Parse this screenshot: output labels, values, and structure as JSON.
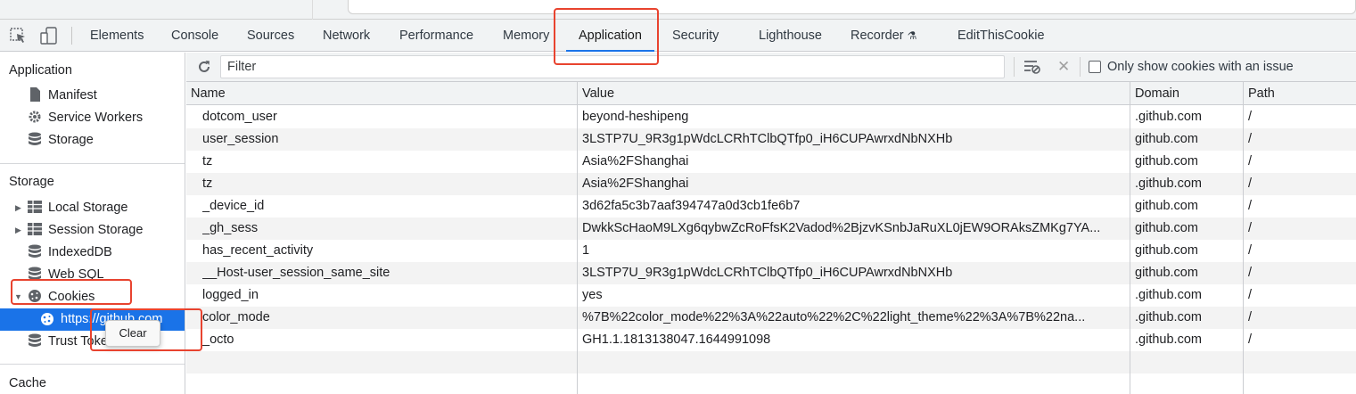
{
  "devtools": {
    "tabs": [
      {
        "label": "Elements"
      },
      {
        "label": "Console"
      },
      {
        "label": "Sources"
      },
      {
        "label": "Network"
      },
      {
        "label": "Performance"
      },
      {
        "label": "Memory"
      },
      {
        "label": "Application",
        "active": true
      },
      {
        "label": "Security"
      },
      {
        "label": "Lighthouse"
      },
      {
        "label": "Recorder"
      },
      {
        "label": "EditThisCookie"
      }
    ]
  },
  "sidebar": {
    "application": {
      "title": "Application",
      "items": [
        {
          "label": "Manifest",
          "icon": "document-icon"
        },
        {
          "label": "Service Workers",
          "icon": "gear-icon"
        },
        {
          "label": "Storage",
          "icon": "database-icon"
        }
      ]
    },
    "storage": {
      "title": "Storage",
      "items": [
        {
          "label": "Local Storage",
          "icon": "grid-icon"
        },
        {
          "label": "Session Storage",
          "icon": "grid-icon"
        },
        {
          "label": "IndexedDB",
          "icon": "database-icon"
        },
        {
          "label": "Web SQL",
          "icon": "database-icon"
        },
        {
          "label": "Cookies",
          "icon": "cookie-icon"
        },
        {
          "label": "https://github.com",
          "icon": "cookie-icon",
          "selected": true
        },
        {
          "label": "Trust Tokens",
          "icon": "database-icon"
        }
      ]
    },
    "cache": {
      "title": "Cache"
    },
    "context_menu": {
      "clear_label": "Clear"
    }
  },
  "toolbar": {
    "filter_placeholder": "Filter",
    "only_issues_label": "Only show cookies with an issue"
  },
  "table": {
    "columns": [
      "Name",
      "Value",
      "Domain",
      "Path"
    ],
    "rows": [
      {
        "name": "dotcom_user",
        "value": "beyond-heshipeng",
        "domain": ".github.com",
        "path": "/"
      },
      {
        "name": "user_session",
        "value": "3LSTP7U_9R3g1pWdcLCRhTClbQTfp0_iH6CUPAwrxdNbNXHb",
        "domain": "github.com",
        "path": "/"
      },
      {
        "name": "tz",
        "value": "Asia%2FShanghai",
        "domain": "github.com",
        "path": "/"
      },
      {
        "name": "tz",
        "value": "Asia%2FShanghai",
        "domain": ".github.com",
        "path": "/"
      },
      {
        "name": "_device_id",
        "value": "3d62fa5c3b7aaf394747a0d3cb1fe6b7",
        "domain": "github.com",
        "path": "/"
      },
      {
        "name": "_gh_sess",
        "value": "DwkkScHaoM9LXg6qybwZcRoFfsK2Vadod%2BjzvKSnbJaRuXL0jEW9ORAksZMKg7YA...",
        "domain": "github.com",
        "path": "/"
      },
      {
        "name": "has_recent_activity",
        "value": "1",
        "domain": "github.com",
        "path": "/"
      },
      {
        "name": "__Host-user_session_same_site",
        "value": "3LSTP7U_9R3g1pWdcLCRhTClbQTfp0_iH6CUPAwrxdNbNXHb",
        "domain": "github.com",
        "path": "/"
      },
      {
        "name": "logged_in",
        "value": "yes",
        "domain": ".github.com",
        "path": "/"
      },
      {
        "name": "color_mode",
        "value": "%7B%22color_mode%22%3A%22auto%22%2C%22light_theme%22%3A%7B%22na...",
        "domain": ".github.com",
        "path": "/"
      },
      {
        "name": "_octo",
        "value": "GH1.1.1813138047.1644991098",
        "domain": ".github.com",
        "path": "/"
      }
    ]
  },
  "colors": {
    "accent": "#1a73e8",
    "annotation": "#e8432f"
  }
}
